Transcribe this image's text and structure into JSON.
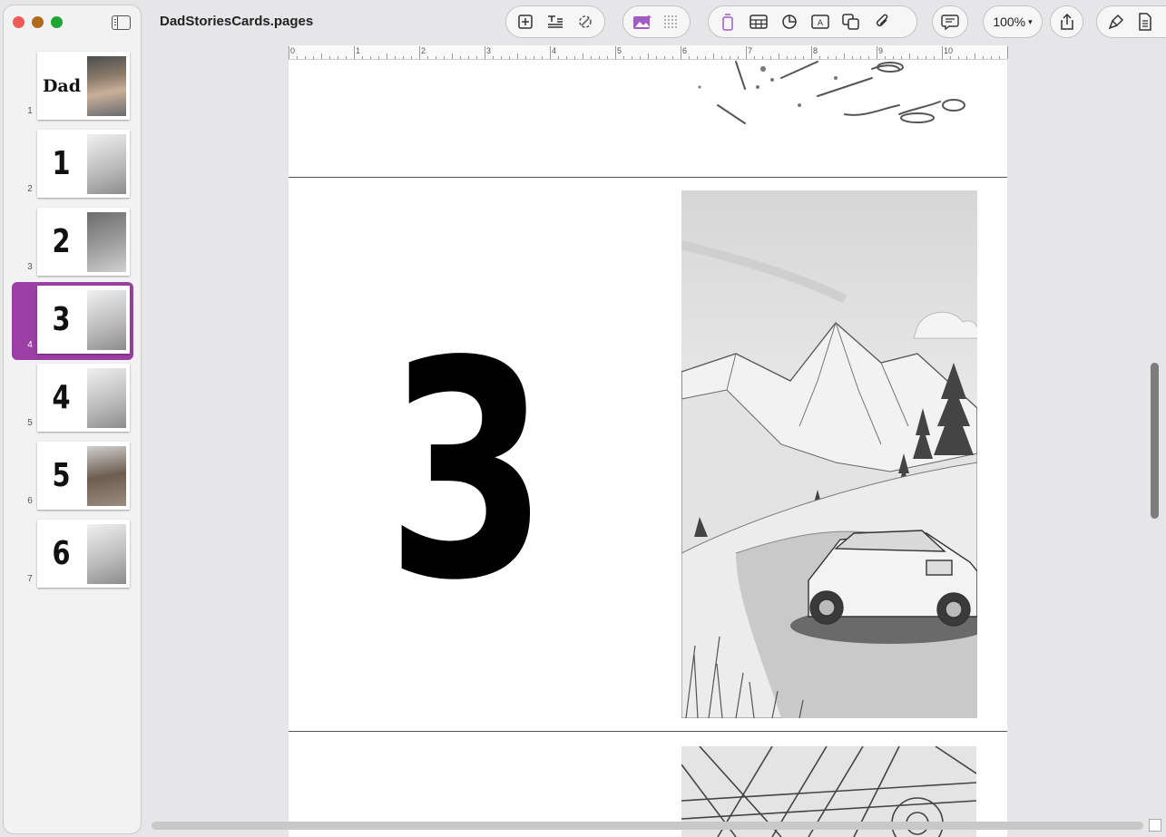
{
  "window": {
    "title": "DadStoriesCards.pages",
    "traffic_lights": {
      "close": "#ee5c58",
      "minimize": "#b06a1c",
      "zoom": "#1fa533"
    }
  },
  "sidebar": {
    "toggle_icon": "sidebar-toggle-icon",
    "thumbnails": [
      {
        "page": "1",
        "label": "Dad",
        "pic": "photo"
      },
      {
        "page": "2",
        "label": "1",
        "pic": "sketch"
      },
      {
        "page": "3",
        "label": "2",
        "pic": "dark"
      },
      {
        "page": "4",
        "label": "3",
        "pic": "sketch",
        "selected": true
      },
      {
        "page": "5",
        "label": "4",
        "pic": "sketch"
      },
      {
        "page": "6",
        "label": "5",
        "pic": "brown"
      },
      {
        "page": "7",
        "label": "6",
        "pic": "sketch"
      }
    ],
    "selected_color": "#9b3fa6"
  },
  "toolbar": {
    "insert_icons": [
      "add-page-icon",
      "text-style-icon",
      "magic-icon"
    ],
    "media_icons": [
      "image-playground-icon",
      "grid-icon"
    ],
    "object_icons": [
      "text-box-icon",
      "table-icon",
      "chart-icon",
      "text-frame-icon",
      "shape-icon",
      "attachment-icon"
    ],
    "comment_icon": "comment-icon",
    "zoom": "100%",
    "share_icon": "share-icon",
    "format_icons": [
      "format-brush-icon",
      "document-icon"
    ]
  },
  "ruler": {
    "labels": [
      "0",
      "1",
      "2",
      "3",
      "4",
      "5",
      "6",
      "7",
      "8",
      "9",
      "10"
    ]
  },
  "page": {
    "big_number": "3"
  }
}
